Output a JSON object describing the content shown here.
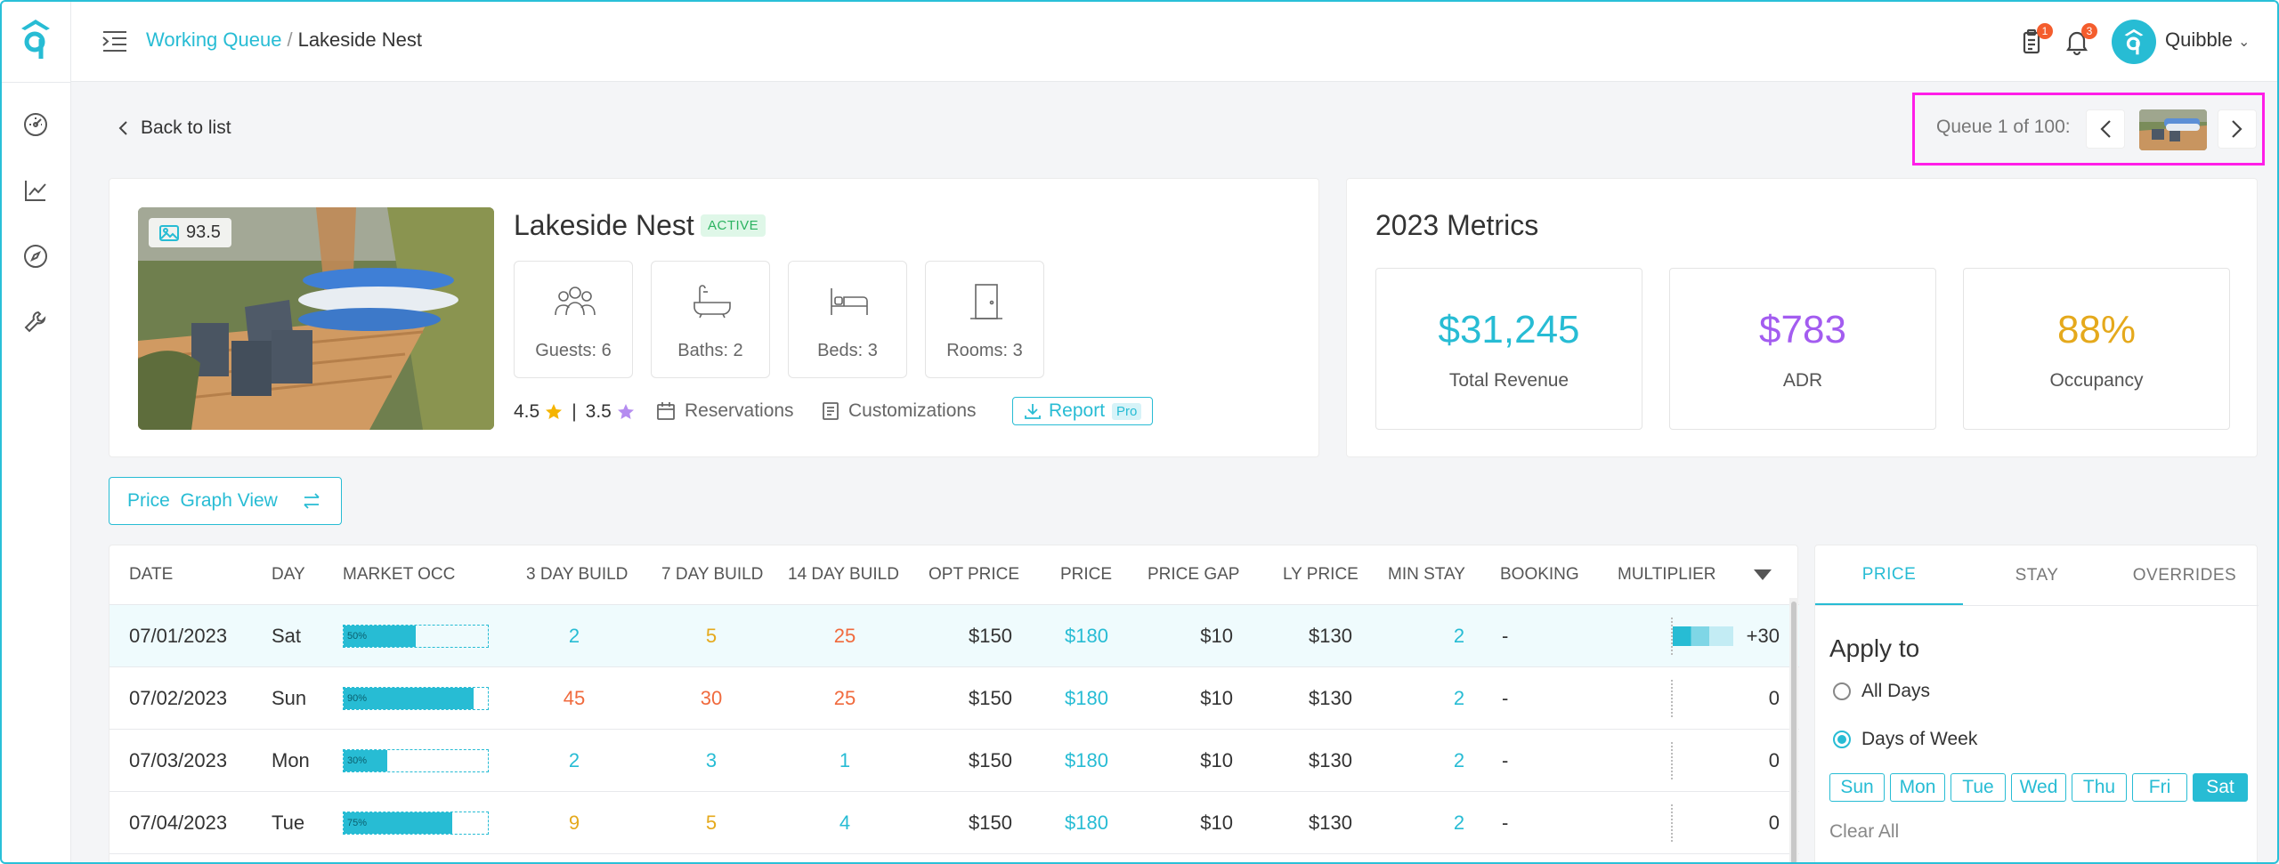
{
  "header": {
    "breadcrumb_parent": "Working Queue",
    "breadcrumb_sep": "/",
    "breadcrumb_current": "Lakeside Nest",
    "clipboard_badge": "1",
    "bell_badge": "3",
    "user_name": "Quibble",
    "user_caret": "⌄"
  },
  "nav": {
    "back_label": "Back to list",
    "queue_label": "Queue 1 of 100:"
  },
  "property": {
    "photo_score": "93.5",
    "name": "Lakeside Nest",
    "status": "ACTIVE",
    "amenities": [
      {
        "label": "Guests: 6"
      },
      {
        "label": "Baths: 2"
      },
      {
        "label": "Beds: 3"
      },
      {
        "label": "Rooms: 3"
      }
    ],
    "rating_1": "4.5",
    "rating_sep": "|",
    "rating_2": "3.5",
    "reservations_label": "Reservations",
    "customizations_label": "Customizations",
    "report_label": "Report",
    "pro_label": "Pro"
  },
  "metrics": {
    "title": "2023 Metrics",
    "items": [
      {
        "value": "$31,245",
        "label": "Total Revenue",
        "color": "#27bcd4"
      },
      {
        "value": "$783",
        "label": "ADR",
        "color": "#a35cf0"
      },
      {
        "value": "88%",
        "label": "Occupancy",
        "color": "#e5a91c"
      }
    ]
  },
  "view_toggle": {
    "label": "Price  Graph View"
  },
  "table": {
    "headers": [
      "DATE",
      "DAY",
      "MARKET OCC",
      "3 DAY BUILD",
      "7 DAY BUILD",
      "14 DAY BUILD",
      "OPT PRICE",
      "PRICE",
      "PRICE GAP",
      "LY PRICE",
      "MIN STAY",
      "BOOKING",
      "MULTIPLIER"
    ],
    "rows": [
      {
        "date": "07/01/2023",
        "day": "Sat",
        "occ": 50,
        "occ_label": "50%",
        "b3": "2",
        "b3c": "#27bcd4",
        "b7": "5",
        "b7c": "#e5a91c",
        "b14": "25",
        "b14c": "#f06a3d",
        "opt": "$150",
        "price": "$180",
        "gap": "$10",
        "ly": "$130",
        "min": "2",
        "booking": "-",
        "mult": "+30",
        "mult_level": 1
      },
      {
        "date": "07/02/2023",
        "day": "Sun",
        "occ": 90,
        "occ_label": "90%",
        "b3": "45",
        "b3c": "#f06a3d",
        "b7": "30",
        "b7c": "#f06a3d",
        "b14": "25",
        "b14c": "#f06a3d",
        "opt": "$150",
        "price": "$180",
        "gap": "$10",
        "ly": "$130",
        "min": "2",
        "booking": "-",
        "mult": "0",
        "mult_level": 0
      },
      {
        "date": "07/03/2023",
        "day": "Mon",
        "occ": 30,
        "occ_label": "30%",
        "b3": "2",
        "b3c": "#27bcd4",
        "b7": "3",
        "b7c": "#27bcd4",
        "b14": "1",
        "b14c": "#27bcd4",
        "opt": "$150",
        "price": "$180",
        "gap": "$10",
        "ly": "$130",
        "min": "2",
        "booking": "-",
        "mult": "0",
        "mult_level": 0
      },
      {
        "date": "07/04/2023",
        "day": "Tue",
        "occ": 75,
        "occ_label": "75%",
        "b3": "9",
        "b3c": "#e5a91c",
        "b7": "5",
        "b7c": "#e5a91c",
        "b14": "4",
        "b14c": "#27bcd4",
        "opt": "$150",
        "price": "$180",
        "gap": "$10",
        "ly": "$130",
        "min": "2",
        "booking": "-",
        "mult": "0",
        "mult_level": 0
      }
    ]
  },
  "panel": {
    "tabs": [
      "PRICE",
      "STAY",
      "OVERRIDES"
    ],
    "apply_title": "Apply to",
    "option_all": "All Days",
    "option_week": "Days of Week",
    "days": [
      "Sun",
      "Mon",
      "Tue",
      "Wed",
      "Thu",
      "Fri",
      "Sat"
    ],
    "selected_day": "Sat",
    "clear_all": "Clear All"
  },
  "colors": {
    "accent": "#27bcd4",
    "highlight": "#ff1ee8"
  }
}
